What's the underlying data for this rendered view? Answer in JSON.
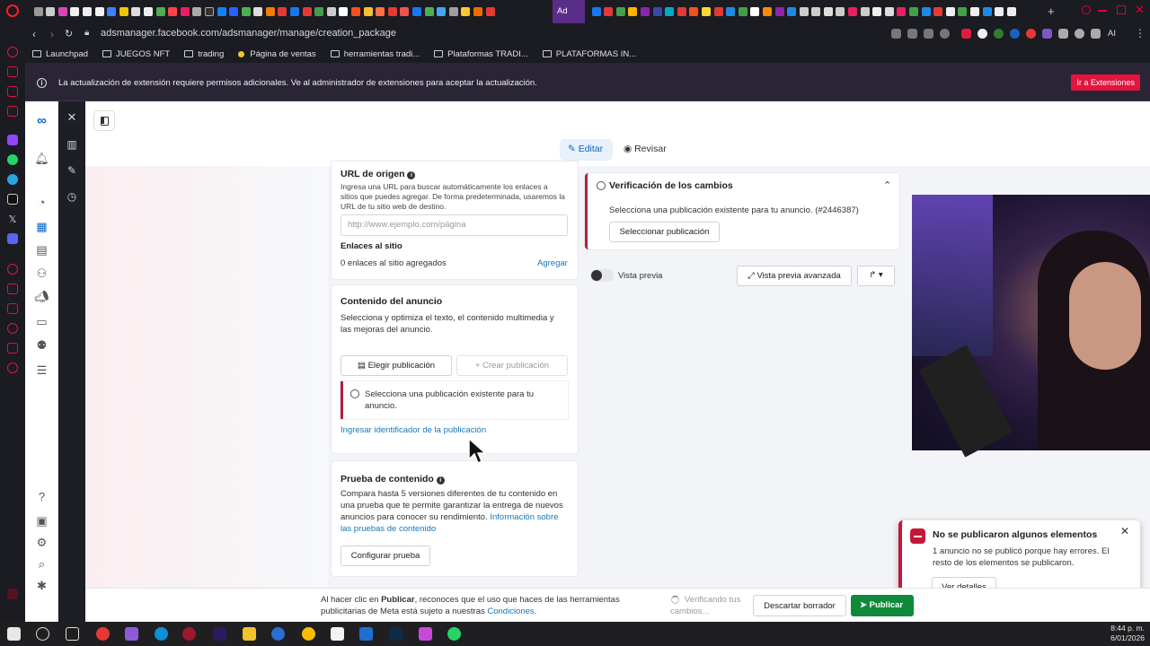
{
  "browser": {
    "url_path_prefix": "adsmanager.facebook.com",
    "url_path": "/adsmanager/manage/creation_package",
    "active_tab_label": "Ad",
    "bookmarks": [
      "Launchpad",
      "JUEGOS NFT",
      "trading",
      "Página de ventas",
      "herramientas tradi...",
      "Plataformas TRADI...",
      "PLATAFORMAS IN..."
    ],
    "ext_label": "AI"
  },
  "infobar": {
    "message": "La actualización de extensión requiere permisos adicionales. Ve al administrador de extensiones para aceptar la actualización.",
    "button": "Ir a Extensiones"
  },
  "header": {
    "edit_tab": "Editar",
    "review_tab": "Revisar"
  },
  "url_section": {
    "title": "URL de origen",
    "description": "Ingresa una URL para buscar automáticamente los enlaces a sitios que puedes agregar. De forma predeterminada, usaremos la URL de tu sitio web de destino.",
    "input_placeholder": "http://www.ejemplo.com/página",
    "site_links_title": "Enlaces al sitio",
    "site_links_count": "0 enlaces al sitio agregados",
    "add_link": "Agregar"
  },
  "ad_content": {
    "title": "Contenido del anuncio",
    "description": "Selecciona y optimiza el texto, el contenido multimedia y las mejoras del anuncio.",
    "choose_post": "Elegir publicación",
    "create_post": "Crear publicación",
    "error": "Selecciona una publicación existente para tu anuncio.",
    "enter_id_link": "Ingresar identificador de la publicación"
  },
  "content_test": {
    "title": "Prueba de contenido",
    "description": "Compara hasta 5 versiones diferentes de tu contenido en una prueba que te permite garantizar la entrega de nuevos anuncios para conocer su rendimiento.",
    "info_link": "Información sobre las pruebas de contenido",
    "configure_button": "Configurar prueba"
  },
  "verification": {
    "title": "Verificación de los cambios",
    "message": "Selecciona una publicación existente para tu anuncio. (#2446387)",
    "select_button": "Seleccionar publicación"
  },
  "preview": {
    "toggle_label": "Vista previa",
    "advanced": "Vista previa avanzada"
  },
  "toast": {
    "title": "No se publicaron algunos elementos",
    "message": "1 anuncio no se publicó porque hay errores. El resto de los elementos se publicaron.",
    "button": "Ver detalles"
  },
  "bottom": {
    "legal_1": "Al hacer clic en ",
    "legal_bold": "Publicar",
    "legal_2": ", reconoces que el uso que haces de las herramientas publicitarias",
    "legal_3": "de Meta está sujeto a nuestras ",
    "legal_link": "Condiciones",
    "legal_end": ".",
    "verifying": "Verificando tus cambios...",
    "discard": "Descartar borrador",
    "publish": "Publicar"
  },
  "taskbar": {
    "time": "8:44 p. m.",
    "date": "6/01/2026"
  },
  "colors": {
    "accent_blue": "#0a66c2",
    "error_red": "#c4173b",
    "publish_green": "#0f8a3a",
    "infobar_button": "#e3143e"
  }
}
